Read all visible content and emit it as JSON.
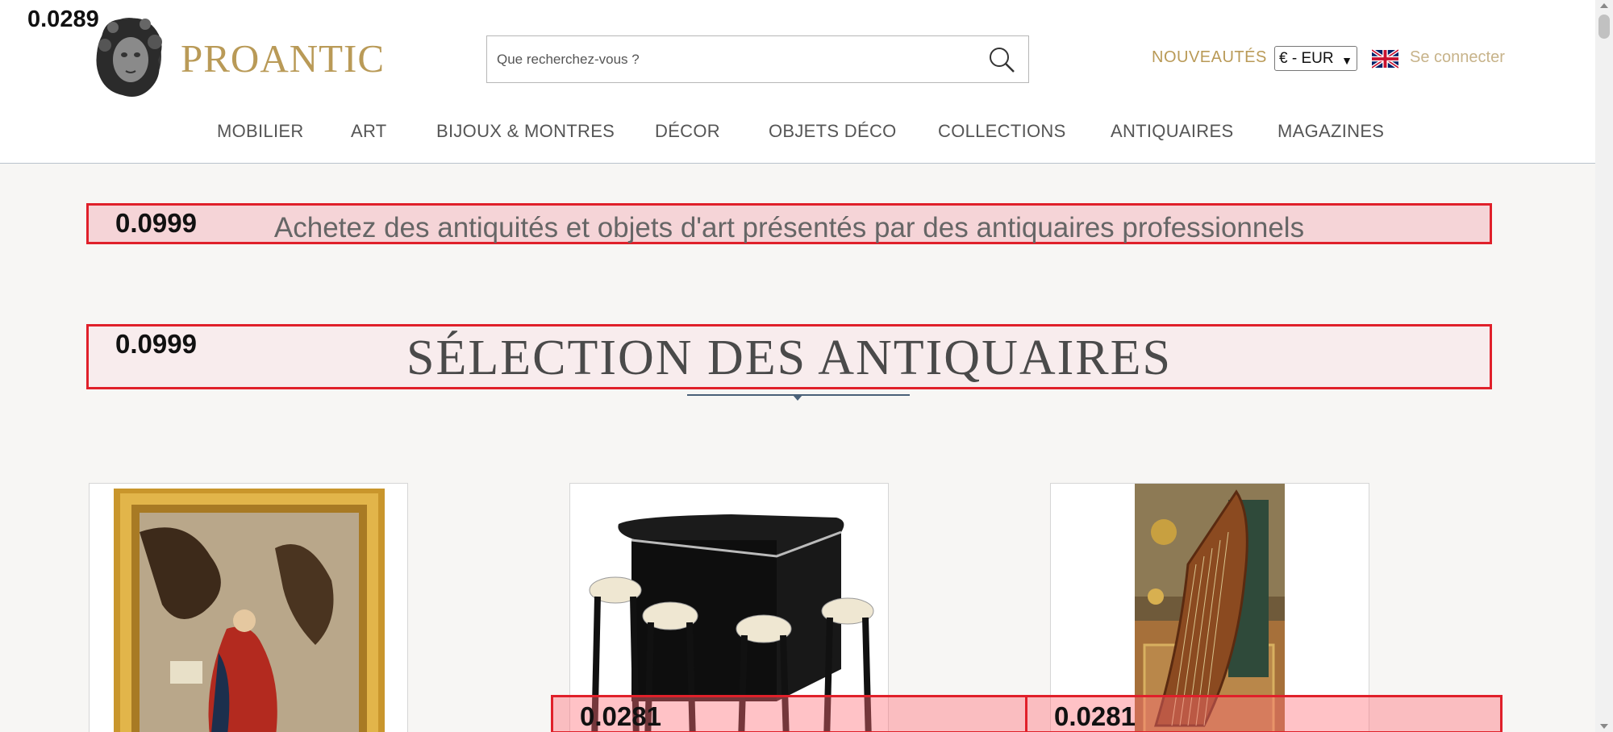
{
  "overlay_scores": {
    "top_left": "0.0289",
    "tagline": "0.0999",
    "section": "0.0999",
    "card_bottom_1": "0.0281",
    "card_bottom_2": "0.0281"
  },
  "header": {
    "brand": "PROANTIC",
    "search_placeholder": "Que recherchez-vous ?",
    "nouveautes": "NOUVEAUTÉS",
    "currency": "€ - EUR",
    "login": "Se connecter"
  },
  "nav": {
    "items": [
      "MOBILIER",
      "ART",
      "BIJOUX & MONTRES",
      "DÉCOR",
      "OBJETS DÉCO",
      "COLLECTIONS",
      "ANTIQUAIRES",
      "MAGAZINES"
    ]
  },
  "main": {
    "tagline": "Achetez des antiquités et objets d'art présentés par des antiquaires professionnels",
    "section_title": "SÉLECTION DES ANTIQUAIRES"
  },
  "products": [
    {
      "icon": "painting-image"
    },
    {
      "icon": "bar-with-stools-image"
    },
    {
      "icon": "harp-image"
    }
  ],
  "colors": {
    "brand_gold": "#b99a57",
    "overlay_red": "#e0202a",
    "background": "#f7f6f4"
  }
}
